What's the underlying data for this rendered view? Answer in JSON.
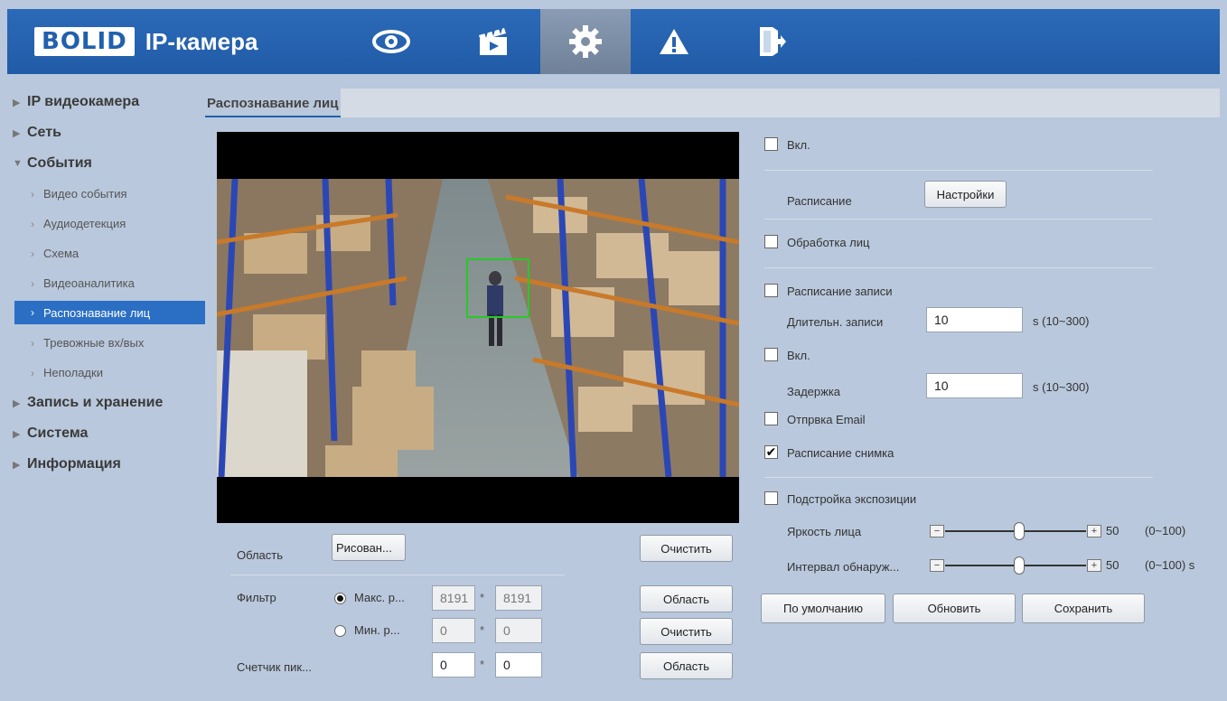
{
  "header": {
    "logo": "BOLID",
    "title": "IP-камера",
    "nav": [
      "live-view-icon",
      "playback-icon",
      "settings-icon",
      "alarm-icon",
      "logout-icon"
    ]
  },
  "sidebar": {
    "items": [
      {
        "label": "IP видеокамера",
        "type": "main",
        "expanded": false
      },
      {
        "label": "Сеть",
        "type": "main",
        "expanded": false
      },
      {
        "label": "События",
        "type": "main",
        "expanded": true
      },
      {
        "label": "Видео события",
        "type": "sub"
      },
      {
        "label": "Аудиодетекция",
        "type": "sub"
      },
      {
        "label": "Схема",
        "type": "sub"
      },
      {
        "label": "Видеоаналитика",
        "type": "sub"
      },
      {
        "label": "Распознавание лиц",
        "type": "sub",
        "active": true
      },
      {
        "label": "Тревожные вх/вых",
        "type": "sub"
      },
      {
        "label": "Неполадки",
        "type": "sub"
      },
      {
        "label": "Запись и хранение",
        "type": "main",
        "expanded": false
      },
      {
        "label": "Система",
        "type": "main",
        "expanded": false
      },
      {
        "label": "Информация",
        "type": "main",
        "expanded": false
      }
    ]
  },
  "tab": {
    "label": "Распознавание лиц"
  },
  "left_form": {
    "area_label": "Область",
    "draw_button": "Рисован...",
    "clear_button_1": "Очистить",
    "filter_label": "Фильтр",
    "max_label": "Макс. р...",
    "max_w": "8191",
    "max_h": "8191",
    "area_button_1": "Область",
    "min_label": "Мин. р...",
    "min_w": "0",
    "min_h": "0",
    "clear_button_2": "Очистить",
    "pixel_counter_label": "Счетчик пик...",
    "pc_w": "0",
    "pc_h": "0",
    "area_button_2": "Область",
    "star": "*"
  },
  "right_form": {
    "enable_label": "Вкл.",
    "enable_checked": false,
    "schedule_label": "Расписание",
    "settings_button": "Настройки",
    "face_processing_label": "Обработка лиц",
    "face_processing_checked": false,
    "record_schedule_label": "Расписание записи",
    "record_schedule_checked": false,
    "record_duration_label": "Длительн. записи",
    "record_duration_value": "10",
    "record_duration_range": "s (10~300)",
    "enable2_label": "Вкл.",
    "enable2_checked": false,
    "delay_label": "Задержка",
    "delay_value": "10",
    "delay_range": "s (10~300)",
    "email_label": "Отпрвка Email",
    "email_checked": false,
    "snapshot_label": "Расписание снимка",
    "snapshot_checked": true,
    "exposure_label": "Подстройка экспозиции",
    "exposure_checked": false,
    "face_brightness_label": "Яркость лица",
    "face_brightness_value": "50",
    "face_brightness_range": "(0~100)",
    "face_brightness_level": 0.5,
    "detect_interval_label": "Интервал обнаруж...",
    "detect_interval_value": "50",
    "detect_interval_range": "(0~100) s",
    "detect_interval_level": 0.5,
    "default_button": "По умолчанию",
    "refresh_button": "Обновить",
    "save_button": "Сохранить",
    "minus": "−",
    "plus": "+",
    "check_mark": "✔"
  }
}
